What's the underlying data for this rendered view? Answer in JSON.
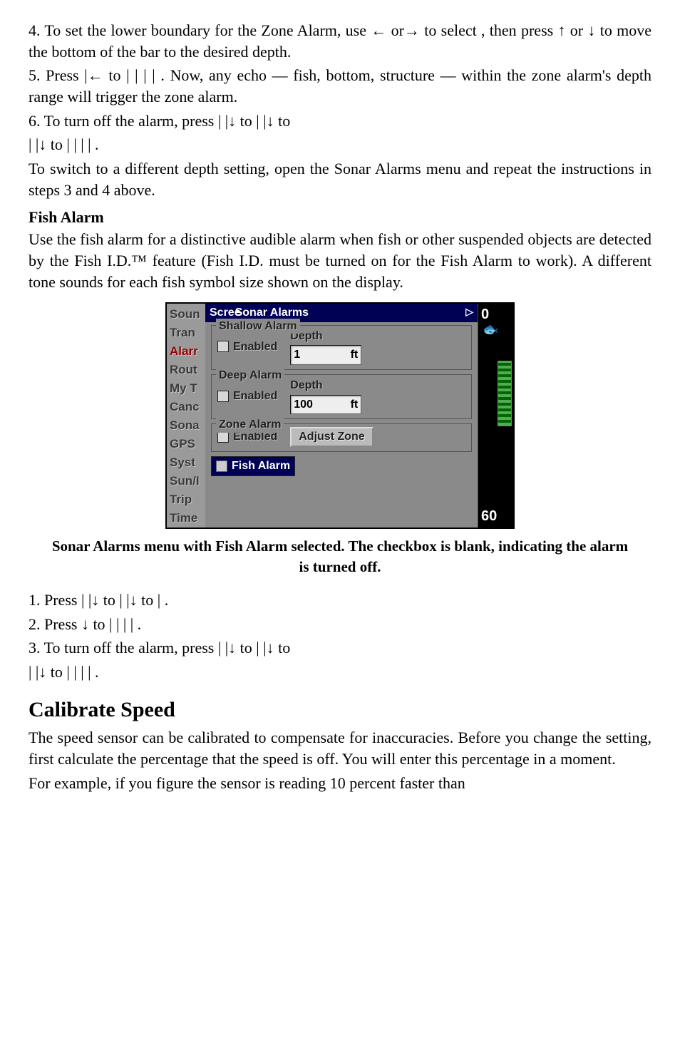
{
  "steps_top": {
    "s4": "4. To set the lower boundary for the Zone Alarm, use ← or→ to select     , then press ↑ or ↓ to move the bottom of the bar to the desired depth.",
    "s5": "5. Press       |← to                                   |       |       |       |      . Now, any echo — fish, bottom, structure — within the zone alarm's depth range will trigger the zone alarm.",
    "s6a": "6. To turn off the alarm, press           |         |↓ to              |       |↓ to",
    "s6b": "             |      |↓ to                         |       |       |       |     ."
  },
  "switch_note": "To switch to a different depth setting, open the Sonar Alarms menu and repeat the instructions in steps 3 and 4 above.",
  "fish_alarm_head": "Fish Alarm",
  "fish_alarm_body": "Use the fish alarm for a distinctive audible alarm when fish or other suspended objects are detected by the Fish I.D.™ feature (Fish I.D. must be turned on for the Fish Alarm to work). A different tone sounds for each fish symbol size shown on the display.",
  "figure": {
    "screen_label": "Scree",
    "title": "Sonar Alarms",
    "side_items": [
      "Soun",
      "Tran",
      "Alarr",
      "Rout",
      "My T",
      "Canc",
      "Sona",
      "GPS",
      "Syst",
      "Sun/I",
      "Trip",
      "Time"
    ],
    "side_selected_index": 2,
    "shallow": {
      "legend": "Shallow Alarm",
      "enabled_label": "Enabled",
      "depth_label": "Depth",
      "depth_value": "1",
      "unit": "ft"
    },
    "deep": {
      "legend": "Deep Alarm",
      "enabled_label": "Enabled",
      "depth_label": "Depth",
      "depth_value": "100",
      "unit": "ft"
    },
    "zone": {
      "legend": "Zone Alarm",
      "enabled_label": "Enabled",
      "button": "Adjust Zone"
    },
    "fish_button": "Fish Alarm",
    "scale_top": "0",
    "scale_bottom": "60"
  },
  "caption": "Sonar Alarms menu with Fish Alarm selected. The checkbox is blank, indicating the alarm is turned off.",
  "steps_bottom": {
    "s1": "1. Press           |        |↓ to              |       |↓ to                        |      .",
    "s2": "2. Press ↓ to                |       |       |       |     .",
    "s3a": "3. To turn off the alarm, press           |         |↓ to              |       |↓ to",
    "s3b": "             |      |↓ to                |       |       |       |     ."
  },
  "calibrate_head": "Calibrate Speed",
  "calibrate_p1": "The speed sensor can be calibrated to compensate for inaccuracies. Before you change the setting, first calculate the percentage that the speed is off. You will enter this percentage in a moment.",
  "calibrate_p2": "For example, if you figure the sensor is reading 10 percent faster than"
}
